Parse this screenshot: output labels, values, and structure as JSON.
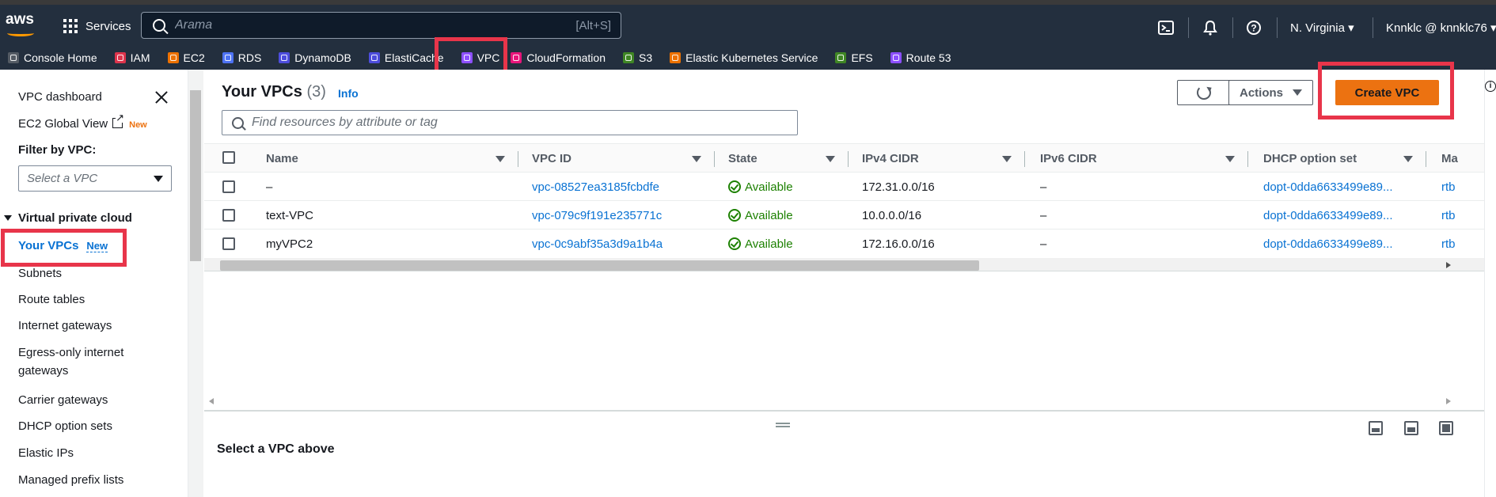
{
  "topbar": {
    "logo_text": "aws",
    "services_label": "Services",
    "search_placeholder": "Arama",
    "search_shortcut": "[Alt+S]",
    "region": "N. Virginia ▾",
    "account": "Knnklc @ knnklc76 ▾"
  },
  "favorites": [
    {
      "label": "Console Home",
      "color": "#545b64"
    },
    {
      "label": "IAM",
      "color": "#dd344c"
    },
    {
      "label": "EC2",
      "color": "#ed7100"
    },
    {
      "label": "RDS",
      "color": "#4d72f3"
    },
    {
      "label": "DynamoDB",
      "color": "#4d4ddc"
    },
    {
      "label": "ElastiCache",
      "color": "#4d4ddc"
    },
    {
      "label": "VPC",
      "color": "#8c4fff"
    },
    {
      "label": "CloudFormation",
      "color": "#e7157b"
    },
    {
      "label": "S3",
      "color": "#3f8624"
    },
    {
      "label": "Elastic Kubernetes Service",
      "color": "#ed7100"
    },
    {
      "label": "EFS",
      "color": "#3f8624"
    },
    {
      "label": "Route 53",
      "color": "#8c4fff"
    }
  ],
  "sidebar": {
    "vpc_dashboard": "VPC dashboard",
    "ec2_global_view": "EC2 Global View",
    "ec2_global_view_badge": "New",
    "filter_label": "Filter by VPC:",
    "filter_placeholder": "Select a VPC",
    "section_title": "Virtual private cloud",
    "your_vpcs": "Your VPCs",
    "your_vpcs_badge": "New",
    "items": [
      "Subnets",
      "Route tables",
      "Internet gateways",
      "Egress-only internet",
      "gateways",
      "Carrier gateways",
      "DHCP option sets",
      "Elastic IPs",
      "Managed prefix lists"
    ]
  },
  "main": {
    "title": "Your VPCs",
    "count": "(3)",
    "info": "Info",
    "actions_label": "Actions",
    "create_label": "Create VPC",
    "search_placeholder": "Find resources by attribute or tag",
    "columns": [
      "Name",
      "VPC ID",
      "State",
      "IPv4 CIDR",
      "IPv6 CIDR",
      "DHCP option set",
      "Ma"
    ],
    "rows": [
      {
        "name": "–",
        "vpc_id": "vpc-08527ea3185fcbdfe",
        "state": "Available",
        "ipv4": "172.31.0.0/16",
        "ipv6": "–",
        "dhcp": "dopt-0dda6633499e89...",
        "main": "rtb"
      },
      {
        "name": "text-VPC",
        "vpc_id": "vpc-079c9f191e235771c",
        "state": "Available",
        "ipv4": "10.0.0.0/16",
        "ipv6": "–",
        "dhcp": "dopt-0dda6633499e89...",
        "main": "rtb"
      },
      {
        "name": "myVPC2",
        "vpc_id": "vpc-0c9abf35a3d9a1b4a",
        "state": "Available",
        "ipv4": "172.16.0.0/16",
        "ipv6": "–",
        "dhcp": "dopt-0dda6633499e89...",
        "main": "rtb"
      }
    ],
    "split_title": "Select a VPC above"
  },
  "colors": {
    "nav_bg": "#232f3e",
    "accent_orange": "#ec7211",
    "link_blue": "#0972d3",
    "success_green": "#1d8102",
    "highlight_red": "#e8354a"
  }
}
